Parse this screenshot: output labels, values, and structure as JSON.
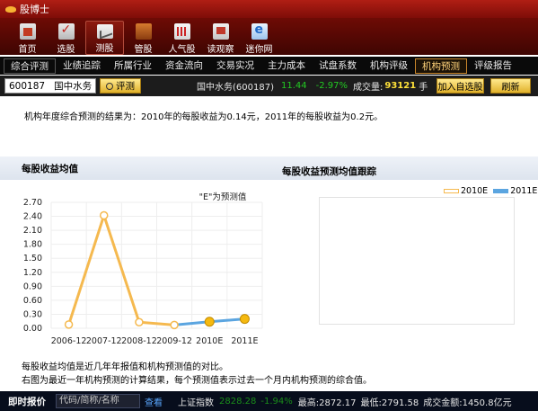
{
  "app": {
    "title": "股博士"
  },
  "toolbar": {
    "items": [
      {
        "label": "首页"
      },
      {
        "label": "选股"
      },
      {
        "label": "测股"
      },
      {
        "label": "管股"
      },
      {
        "label": "人气股"
      },
      {
        "label": "读观察"
      },
      {
        "label": "迷你网"
      }
    ]
  },
  "tabs": [
    {
      "label": "综合评测"
    },
    {
      "label": "业绩追踪"
    },
    {
      "label": "所属行业"
    },
    {
      "label": "资金流向"
    },
    {
      "label": "交易实况"
    },
    {
      "label": "主力成本"
    },
    {
      "label": "试盘系数"
    },
    {
      "label": "机构评级"
    },
    {
      "label": "机构预测"
    },
    {
      "label": "评级报告"
    }
  ],
  "stock": {
    "code": "600187",
    "name": "国中水务",
    "eval_label": "评测",
    "info_name": "国中水务(600187)",
    "price": "11.44",
    "change": "-2.97%",
    "volume_label": "成交量:",
    "volume": "93121",
    "volume_unit": "手",
    "add_label": "加入自选股",
    "refresh_label": "刷新"
  },
  "content": {
    "summary": "机构年度综合预测的结果为：2010年的每股收益为0.14元，2011年的每股收益为0.2元。",
    "left_title": "每股收益均值",
    "right_title": "每股收益预测均值跟踪",
    "note1": "每股收益均值是近几年年报值和机构预测值的对比。",
    "note2": "右图为最近一年机构预测的计算结果，每个预测值表示过去一个月内机构预测的综合值。"
  },
  "chart_data": [
    {
      "type": "line",
      "title": "每股收益均值",
      "annotation": "\"E\"为预测值",
      "categories": [
        "2006-12",
        "2007-12",
        "2008-12",
        "2009-12",
        "2010E",
        "2011E"
      ],
      "series": [
        {
          "values": [
            0.08,
            2.42,
            0.13,
            0.07,
            null,
            null
          ],
          "color": "#f5b94f"
        },
        {
          "values": [
            null,
            null,
            null,
            0.07,
            0.14,
            0.2
          ],
          "color": "#5ba5e0"
        }
      ],
      "ylim": [
        0,
        2.7
      ],
      "yticks": [
        "2.70",
        "2.40",
        "2.10",
        "1.80",
        "1.50",
        "1.20",
        "0.90",
        "0.60",
        "0.30",
        "0.00"
      ],
      "grid": true
    },
    {
      "type": "line",
      "title": "每股收益预测均值跟踪",
      "series": [
        {
          "name": "2010E",
          "values": [],
          "color": "#f5b94f"
        },
        {
          "name": "2011E",
          "values": [],
          "color": "#5ba5e0"
        }
      ],
      "legend": "top-right"
    }
  ],
  "bottombar": {
    "label": "即时报价",
    "input_placeholder": "代码/简称/名称",
    "link": "查看",
    "index_name": "上证指数",
    "index_value": "2828.28",
    "index_change": "-1.94%",
    "high": "最高:2872.17",
    "low": "最低:2791.58",
    "amount": "成交金额:1450.8亿元"
  }
}
